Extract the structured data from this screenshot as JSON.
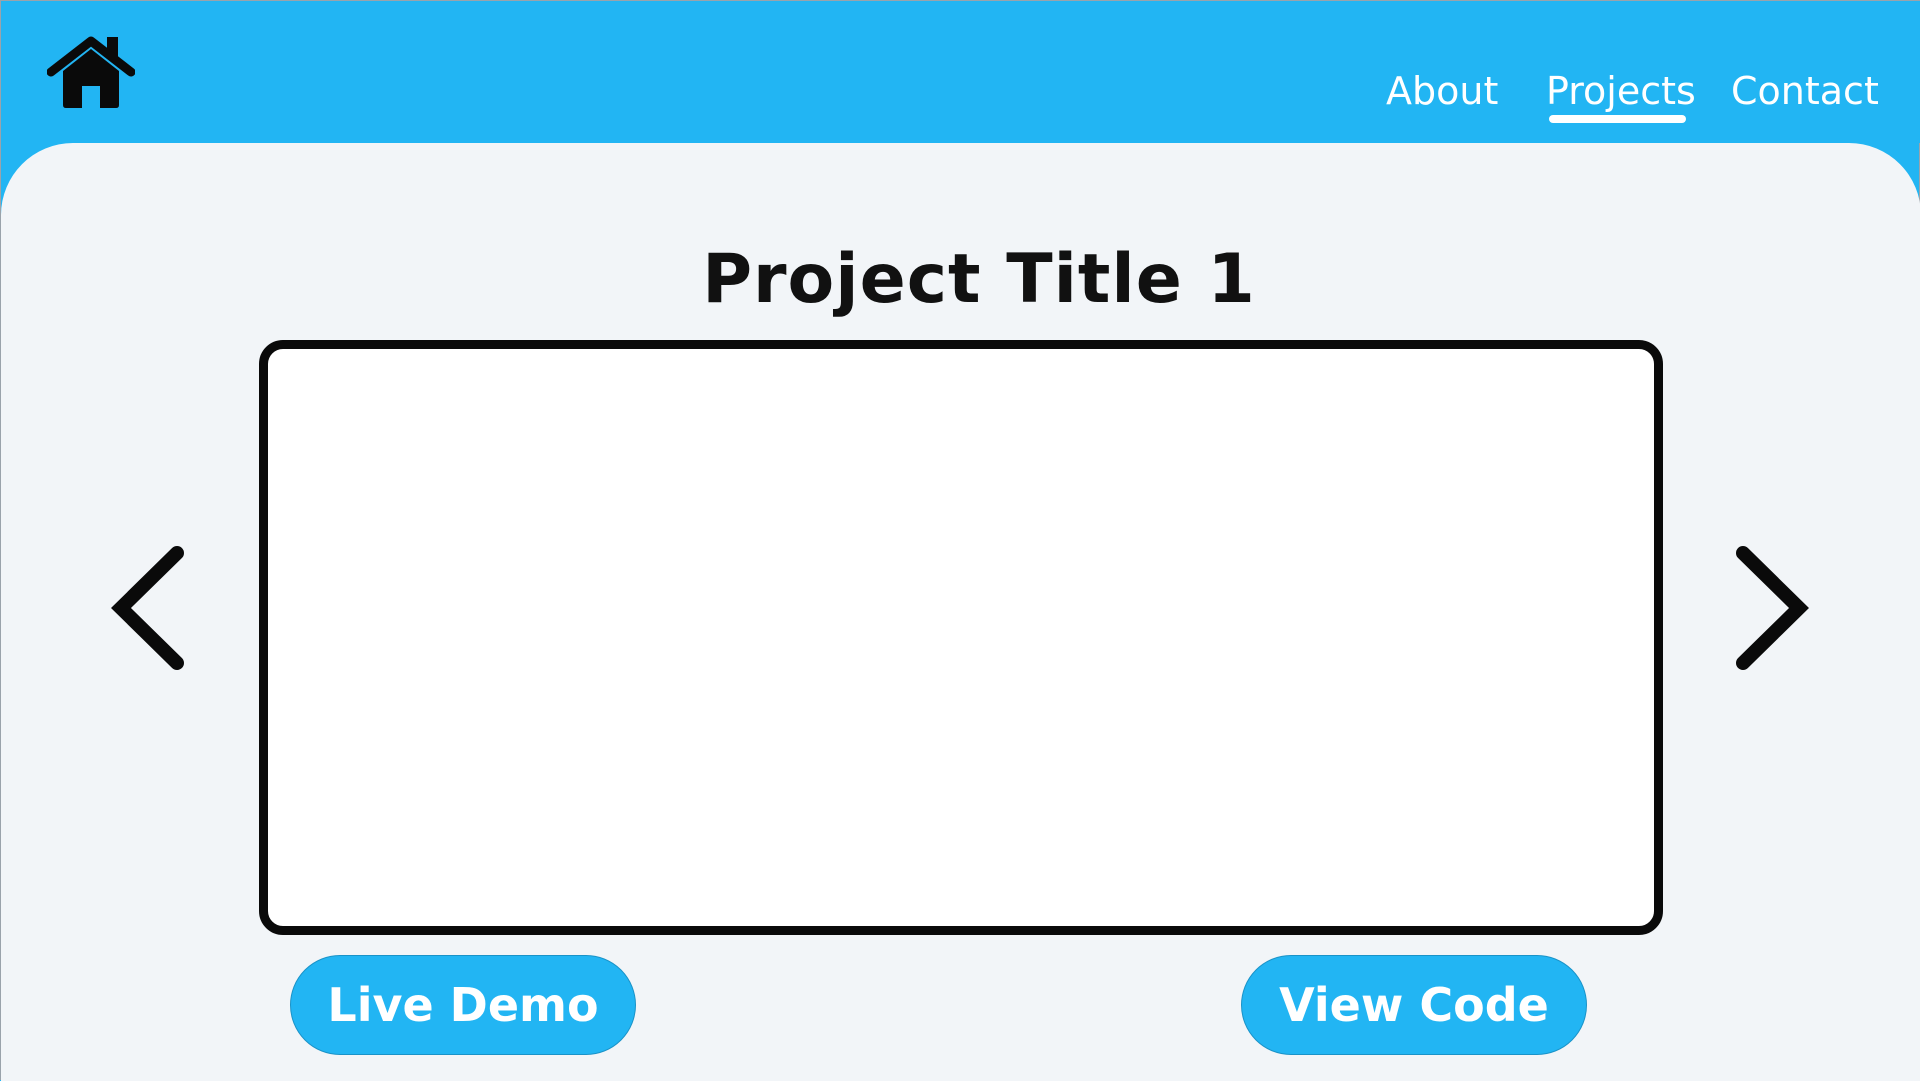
{
  "header": {
    "home_icon": "house-icon",
    "nav": [
      {
        "label": "About"
      },
      {
        "label": "Projects",
        "active": true
      },
      {
        "label": "Contact"
      }
    ]
  },
  "main": {
    "title": "Project Title 1",
    "prev_icon": "chevron-left-icon",
    "next_icon": "chevron-right-icon",
    "live_demo_label": "Live Demo",
    "view_code_label": "View Code"
  },
  "colors": {
    "header_bg": "#22b5f3",
    "content_bg": "#f2f5f8",
    "text_dark": "#111111",
    "button_bg": "#22b5f3",
    "button_text": "#ffffff"
  }
}
